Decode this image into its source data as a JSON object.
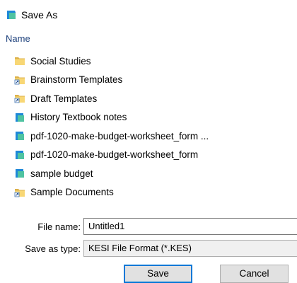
{
  "dialog": {
    "title": "Save As"
  },
  "list": {
    "column_header": "Name",
    "items": [
      {
        "label": "Social Studies",
        "icon": "folder-icon"
      },
      {
        "label": "Brainstorm Templates",
        "icon": "folder-shortcut-icon"
      },
      {
        "label": "Draft Templates",
        "icon": "folder-shortcut-icon"
      },
      {
        "label": "History Textbook notes",
        "icon": "document-file-icon"
      },
      {
        "label": "pdf-1020-make-budget-worksheet_form ...",
        "icon": "document-file-icon"
      },
      {
        "label": "pdf-1020-make-budget-worksheet_form",
        "icon": "document-file-icon"
      },
      {
        "label": "sample budget",
        "icon": "document-file-icon"
      },
      {
        "label": "Sample Documents",
        "icon": "folder-shortcut-icon"
      }
    ]
  },
  "form": {
    "file_name_label": "File name:",
    "file_name_value": "Untitled1",
    "save_type_label": "Save as type:",
    "save_type_value": "KESI File Format (*.KES)"
  },
  "buttons": {
    "save": "Save",
    "cancel": "Cancel"
  },
  "colors": {
    "folder": "#f8d775",
    "doc_blue": "#1e88d8",
    "doc_teal": "#4fc3a1",
    "header_text": "#1a3e7a",
    "accent": "#0078d7"
  }
}
